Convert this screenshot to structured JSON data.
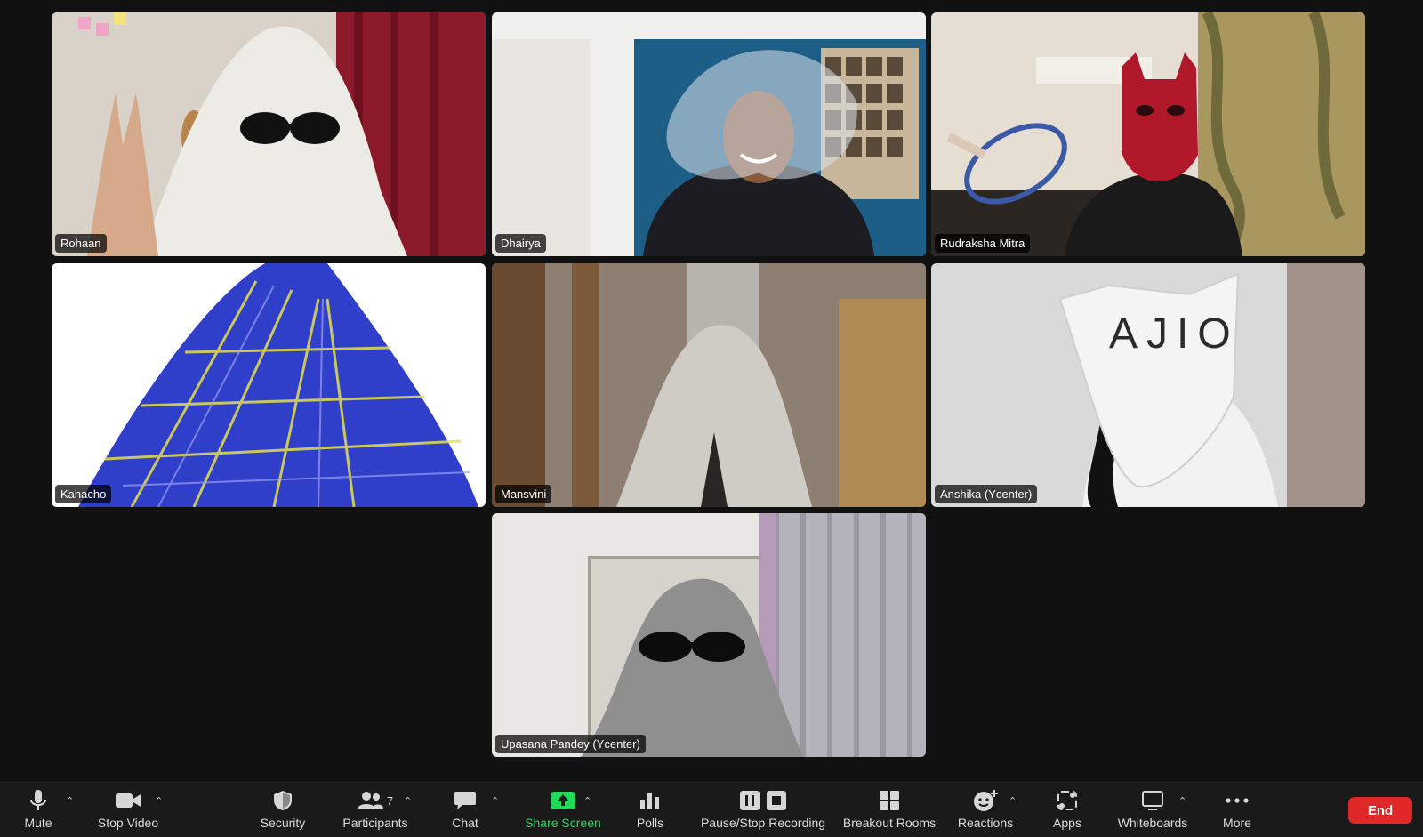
{
  "participants": [
    {
      "name": "Rohaan"
    },
    {
      "name": "Dhairya"
    },
    {
      "name": "Rudraksha Mitra"
    },
    {
      "name": "Kahacho"
    },
    {
      "name": "Mansvini"
    },
    {
      "name": "Anshika (Ycenter)"
    },
    {
      "name": "Upasana Pandey (Ycenter)"
    }
  ],
  "toolbar": {
    "mute": {
      "label": "Mute",
      "icon": "microphone-icon"
    },
    "stop_video": {
      "label": "Stop Video",
      "icon": "video-camera-icon"
    },
    "security": {
      "label": "Security",
      "icon": "shield-icon"
    },
    "participants": {
      "label": "Participants",
      "icon": "people-icon",
      "count": "7"
    },
    "chat": {
      "label": "Chat",
      "icon": "chat-bubble-icon"
    },
    "share_screen": {
      "label": "Share Screen",
      "icon": "share-arrow-icon",
      "color": "#23d959"
    },
    "polls": {
      "label": "Polls",
      "icon": "bar-chart-icon"
    },
    "recording": {
      "label": "Pause/Stop Recording",
      "icon": "pause-stop-icon"
    },
    "breakout_rooms": {
      "label": "Breakout Rooms",
      "icon": "grid-icon"
    },
    "reactions": {
      "label": "Reactions",
      "icon": "smiley-plus-icon"
    },
    "apps": {
      "label": "Apps",
      "icon": "apps-icon"
    },
    "whiteboards": {
      "label": "Whiteboards",
      "icon": "whiteboard-icon"
    },
    "more": {
      "label": "More",
      "icon": "ellipsis-icon"
    },
    "end": {
      "label": "End",
      "color": "#e02828"
    }
  },
  "colors": {
    "active_speaker": "#2ec04f",
    "background": "#111111"
  }
}
